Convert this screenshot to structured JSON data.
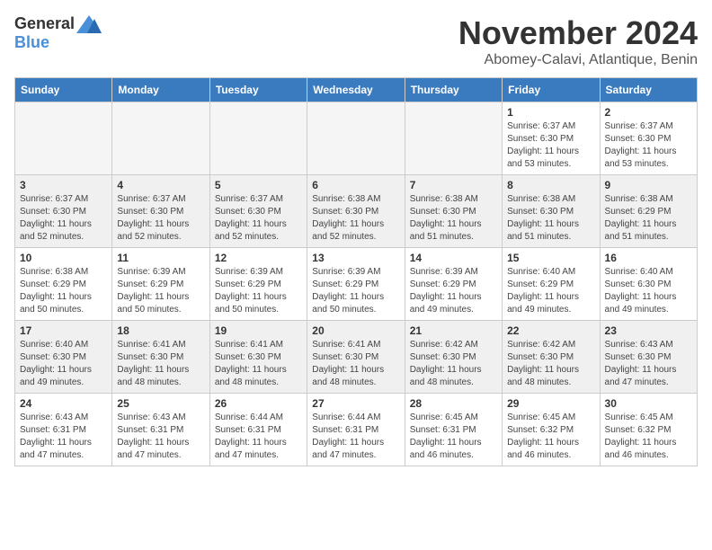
{
  "logo": {
    "general": "General",
    "blue": "Blue"
  },
  "header": {
    "month": "November 2024",
    "location": "Abomey-Calavi, Atlantique, Benin"
  },
  "weekdays": [
    "Sunday",
    "Monday",
    "Tuesday",
    "Wednesday",
    "Thursday",
    "Friday",
    "Saturday"
  ],
  "weeks": [
    [
      {
        "day": "",
        "info": ""
      },
      {
        "day": "",
        "info": ""
      },
      {
        "day": "",
        "info": ""
      },
      {
        "day": "",
        "info": ""
      },
      {
        "day": "",
        "info": ""
      },
      {
        "day": "1",
        "info": "Sunrise: 6:37 AM\nSunset: 6:30 PM\nDaylight: 11 hours and 53 minutes."
      },
      {
        "day": "2",
        "info": "Sunrise: 6:37 AM\nSunset: 6:30 PM\nDaylight: 11 hours and 53 minutes."
      }
    ],
    [
      {
        "day": "3",
        "info": "Sunrise: 6:37 AM\nSunset: 6:30 PM\nDaylight: 11 hours and 52 minutes."
      },
      {
        "day": "4",
        "info": "Sunrise: 6:37 AM\nSunset: 6:30 PM\nDaylight: 11 hours and 52 minutes."
      },
      {
        "day": "5",
        "info": "Sunrise: 6:37 AM\nSunset: 6:30 PM\nDaylight: 11 hours and 52 minutes."
      },
      {
        "day": "6",
        "info": "Sunrise: 6:38 AM\nSunset: 6:30 PM\nDaylight: 11 hours and 52 minutes."
      },
      {
        "day": "7",
        "info": "Sunrise: 6:38 AM\nSunset: 6:30 PM\nDaylight: 11 hours and 51 minutes."
      },
      {
        "day": "8",
        "info": "Sunrise: 6:38 AM\nSunset: 6:30 PM\nDaylight: 11 hours and 51 minutes."
      },
      {
        "day": "9",
        "info": "Sunrise: 6:38 AM\nSunset: 6:29 PM\nDaylight: 11 hours and 51 minutes."
      }
    ],
    [
      {
        "day": "10",
        "info": "Sunrise: 6:38 AM\nSunset: 6:29 PM\nDaylight: 11 hours and 50 minutes."
      },
      {
        "day": "11",
        "info": "Sunrise: 6:39 AM\nSunset: 6:29 PM\nDaylight: 11 hours and 50 minutes."
      },
      {
        "day": "12",
        "info": "Sunrise: 6:39 AM\nSunset: 6:29 PM\nDaylight: 11 hours and 50 minutes."
      },
      {
        "day": "13",
        "info": "Sunrise: 6:39 AM\nSunset: 6:29 PM\nDaylight: 11 hours and 50 minutes."
      },
      {
        "day": "14",
        "info": "Sunrise: 6:39 AM\nSunset: 6:29 PM\nDaylight: 11 hours and 49 minutes."
      },
      {
        "day": "15",
        "info": "Sunrise: 6:40 AM\nSunset: 6:29 PM\nDaylight: 11 hours and 49 minutes."
      },
      {
        "day": "16",
        "info": "Sunrise: 6:40 AM\nSunset: 6:30 PM\nDaylight: 11 hours and 49 minutes."
      }
    ],
    [
      {
        "day": "17",
        "info": "Sunrise: 6:40 AM\nSunset: 6:30 PM\nDaylight: 11 hours and 49 minutes."
      },
      {
        "day": "18",
        "info": "Sunrise: 6:41 AM\nSunset: 6:30 PM\nDaylight: 11 hours and 48 minutes."
      },
      {
        "day": "19",
        "info": "Sunrise: 6:41 AM\nSunset: 6:30 PM\nDaylight: 11 hours and 48 minutes."
      },
      {
        "day": "20",
        "info": "Sunrise: 6:41 AM\nSunset: 6:30 PM\nDaylight: 11 hours and 48 minutes."
      },
      {
        "day": "21",
        "info": "Sunrise: 6:42 AM\nSunset: 6:30 PM\nDaylight: 11 hours and 48 minutes."
      },
      {
        "day": "22",
        "info": "Sunrise: 6:42 AM\nSunset: 6:30 PM\nDaylight: 11 hours and 48 minutes."
      },
      {
        "day": "23",
        "info": "Sunrise: 6:43 AM\nSunset: 6:30 PM\nDaylight: 11 hours and 47 minutes."
      }
    ],
    [
      {
        "day": "24",
        "info": "Sunrise: 6:43 AM\nSunset: 6:31 PM\nDaylight: 11 hours and 47 minutes."
      },
      {
        "day": "25",
        "info": "Sunrise: 6:43 AM\nSunset: 6:31 PM\nDaylight: 11 hours and 47 minutes."
      },
      {
        "day": "26",
        "info": "Sunrise: 6:44 AM\nSunset: 6:31 PM\nDaylight: 11 hours and 47 minutes."
      },
      {
        "day": "27",
        "info": "Sunrise: 6:44 AM\nSunset: 6:31 PM\nDaylight: 11 hours and 47 minutes."
      },
      {
        "day": "28",
        "info": "Sunrise: 6:45 AM\nSunset: 6:31 PM\nDaylight: 11 hours and 46 minutes."
      },
      {
        "day": "29",
        "info": "Sunrise: 6:45 AM\nSunset: 6:32 PM\nDaylight: 11 hours and 46 minutes."
      },
      {
        "day": "30",
        "info": "Sunrise: 6:45 AM\nSunset: 6:32 PM\nDaylight: 11 hours and 46 minutes."
      }
    ]
  ]
}
